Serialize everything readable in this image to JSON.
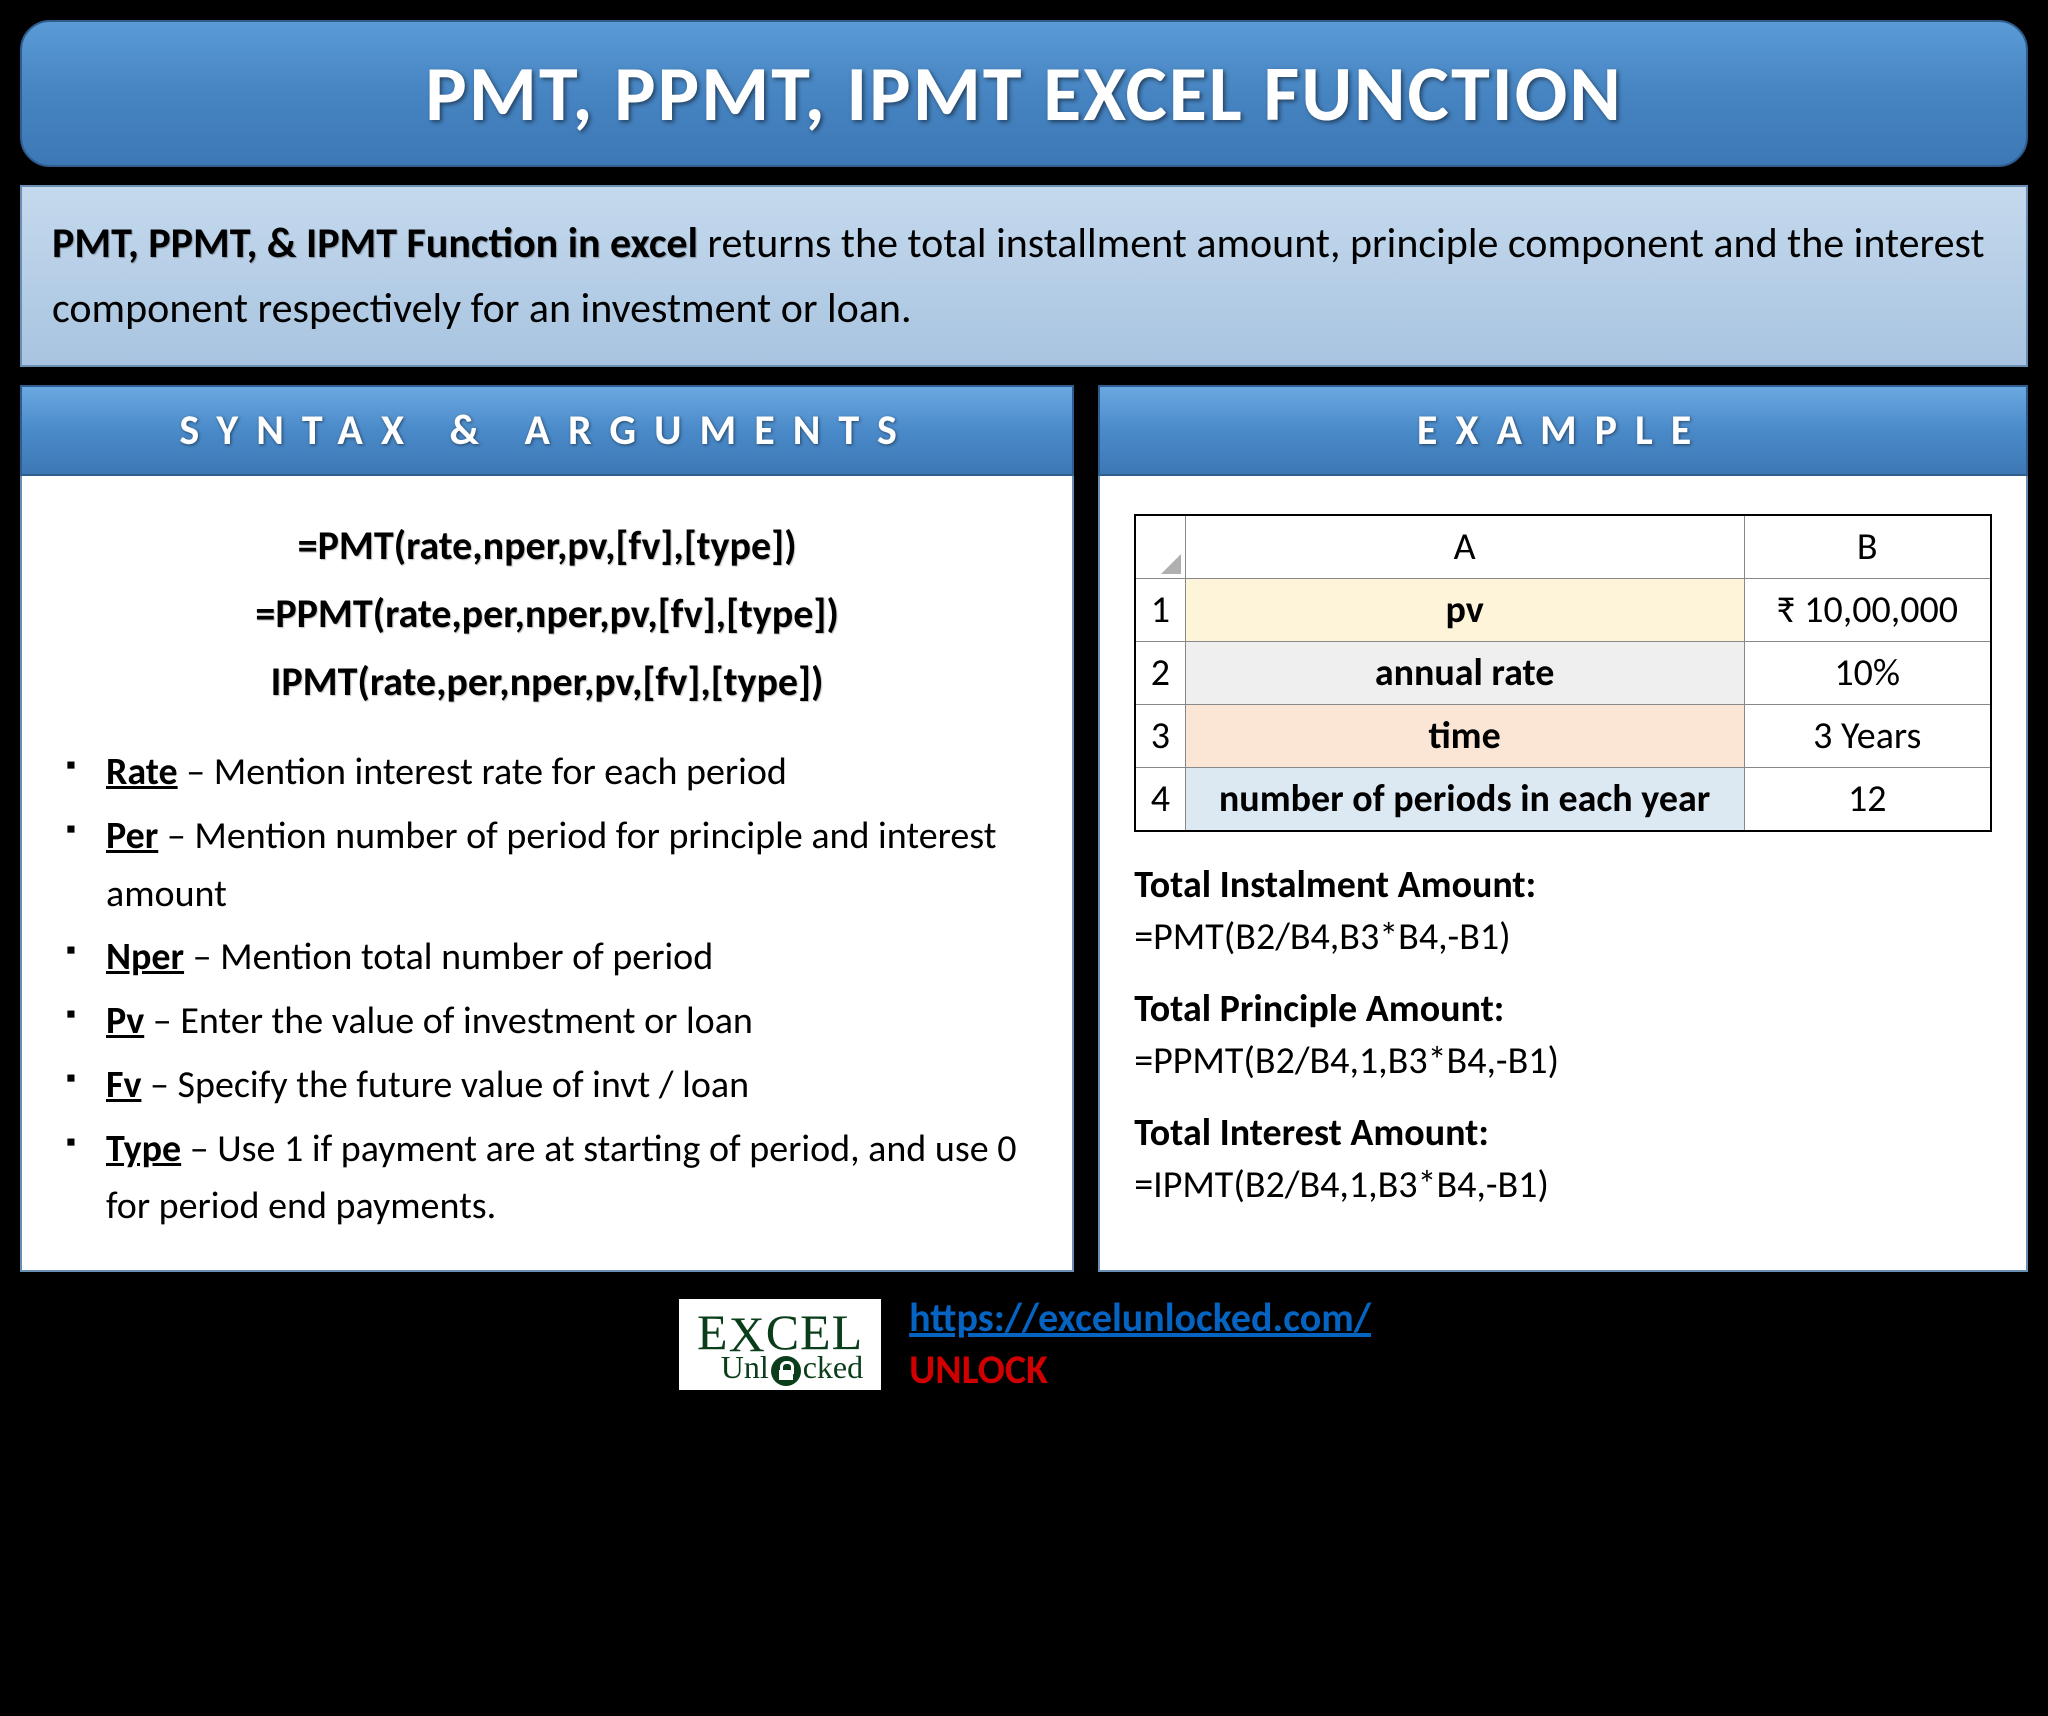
{
  "title": "PMT, PPMT, IPMT EXCEL FUNCTION",
  "description": {
    "bold": "PMT, PPMT, & IPMT Function in excel",
    "rest": " returns the total installment amount, principle component and the interest component respectively for an investment or loan."
  },
  "syntax_header": "SYNTAX & ARGUMENTS",
  "example_header": "EXAMPLE",
  "syntax": {
    "line1": "=PMT(rate,nper,pv,[fv],[type])",
    "line2": "=PPMT(rate,per,nper,pv,[fv],[type])",
    "line3": "IPMT(rate,per,nper,pv,[fv],[type])"
  },
  "args": [
    {
      "name": "Rate",
      "desc": " – Mention interest rate for each period"
    },
    {
      "name": "Per",
      "desc": " – Mention number of period for principle and interest amount"
    },
    {
      "name": "Nper",
      "desc": " – Mention total number of period"
    },
    {
      "name": "Pv",
      "desc": " – Enter the value of investment or loan"
    },
    {
      "name": "Fv",
      "desc": " – Specify the future value of invt / loan"
    },
    {
      "name": "Type",
      "desc": " – Use 1 if payment are at starting of period, and use 0 for period end payments."
    }
  ],
  "table": {
    "colA": "A",
    "colB": "B",
    "rows": [
      {
        "n": "1",
        "a": "pv",
        "b": "₹ 10,00,000",
        "bg": "bg-yellow"
      },
      {
        "n": "2",
        "a": "annual rate",
        "b": "10%",
        "bg": "bg-gray"
      },
      {
        "n": "3",
        "a": "time",
        "b": "3 Years",
        "bg": "bg-peach"
      },
      {
        "n": "4",
        "a": "number of periods in each year",
        "b": "12",
        "bg": "bg-blue"
      }
    ]
  },
  "examples": [
    {
      "label": "Total Instalment Amount:",
      "formula": "=PMT(B2/B4,B3*B4,-B1)"
    },
    {
      "label": "Total Principle Amount:",
      "formula": "=PPMT(B2/B4,1,B3*B4,-B1)"
    },
    {
      "label": "Total Interest Amount:",
      "formula": "=IPMT(B2/B4,1,B3*B4,-B1)"
    }
  ],
  "footer": {
    "logo_top_pre": "E",
    "logo_top_x": "X",
    "logo_top_post": "CEL",
    "logo_bottom_pre": "Unl",
    "logo_bottom_post": "cked",
    "link": "https://excelunlocked.com/",
    "unlock": "UNLOCK"
  }
}
